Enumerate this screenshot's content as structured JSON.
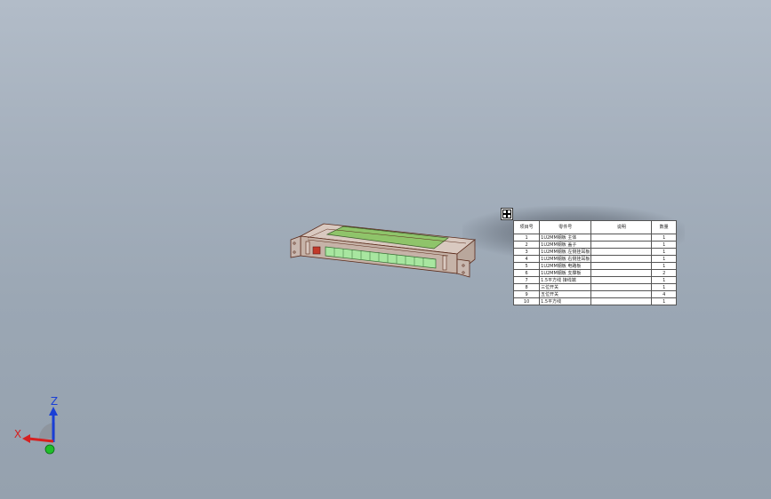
{
  "viewport": {
    "background_top": "#b2bcc8",
    "background_bottom": "#95a1ae"
  },
  "model": {
    "accent_green": "#a8e6a0",
    "edge_color": "#5a2a1a",
    "panel_green": "#8fc46a"
  },
  "bom": {
    "headers": {
      "item_no": "项目号",
      "part_no": "零件号",
      "description": "说明",
      "qty": "数量"
    },
    "rows": [
      {
        "item": "1",
        "part": "1U2MM钢板 主体",
        "desc": "",
        "qty": "1"
      },
      {
        "item": "2",
        "part": "1U2MM钢板 盖子",
        "desc": "",
        "qty": "1"
      },
      {
        "item": "3",
        "part": "1U2MM钢板 左侧挂耳板",
        "desc": "",
        "qty": "1"
      },
      {
        "item": "4",
        "part": "1U2MM钢板 右侧挂耳板",
        "desc": "",
        "qty": "1"
      },
      {
        "item": "5",
        "part": "1U2MM钢板 电路板",
        "desc": "",
        "qty": "1"
      },
      {
        "item": "6",
        "part": "1U2MM钢板 支撑板",
        "desc": "",
        "qty": "2"
      },
      {
        "item": "7",
        "part": "1.5平方线 接线端",
        "desc": "",
        "qty": "1"
      },
      {
        "item": "8",
        "part": "三位开关",
        "desc": "",
        "qty": "1"
      },
      {
        "item": "9",
        "part": "五位开关",
        "desc": "",
        "qty": "4"
      },
      {
        "item": "10",
        "part": "1.5平方线",
        "desc": "",
        "qty": "1"
      }
    ]
  },
  "triad": {
    "z_label": "Z",
    "x_label": "X",
    "z_color": "#1a3fd6",
    "x_color": "#d62020",
    "y_color": "#1fbf2a"
  },
  "icons": {
    "move_handle": "move-arrows-icon"
  }
}
